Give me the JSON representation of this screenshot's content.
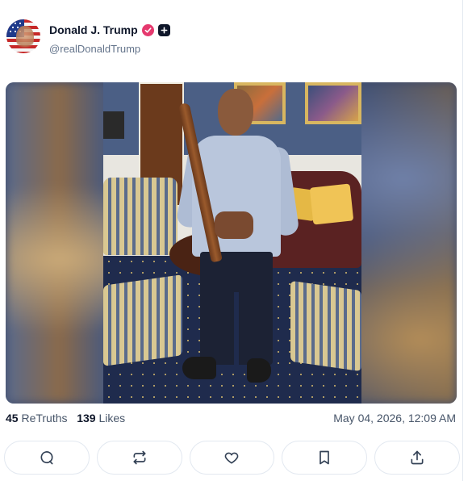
{
  "post": {
    "author": {
      "display_name": "Donald J. Trump",
      "handle": "@realDonaldTrump",
      "verified_icon": "verified-badge-icon",
      "badge_icon": "plus-badge-icon"
    },
    "media": {
      "type": "photo"
    },
    "stats": {
      "retruths_count": "45",
      "retruths_label": "ReTruths",
      "likes_count": "139",
      "likes_label": "Likes"
    },
    "timestamp": "May 04, 2026, 12:09 AM"
  },
  "actions": [
    {
      "icon": "reply-icon"
    },
    {
      "icon": "retruth-icon"
    },
    {
      "icon": "heart-icon"
    },
    {
      "icon": "bookmark-icon"
    },
    {
      "icon": "share-icon"
    }
  ],
  "colors": {
    "verified": "#e5396e",
    "text_primary": "#0f172a",
    "text_secondary": "#64748b",
    "border": "#e2e8f0"
  }
}
